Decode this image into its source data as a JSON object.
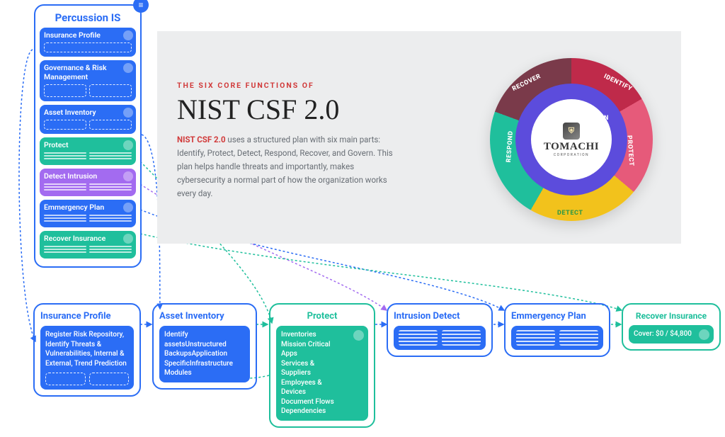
{
  "sidebar": {
    "title": "Percussion IS",
    "items": [
      {
        "label": "Insurance Profile",
        "color": "blue",
        "variant": "bar"
      },
      {
        "label": "Governance & Risk Management",
        "color": "blue",
        "variant": "row"
      },
      {
        "label": "Asset Inventory",
        "color": "blue",
        "variant": "row"
      },
      {
        "label": "Protect",
        "color": "teal",
        "variant": "lines"
      },
      {
        "label": "Detect Intrusion",
        "color": "purple",
        "variant": "lines"
      },
      {
        "label": "Emmergency Plan",
        "color": "blue",
        "variant": "lines"
      },
      {
        "label": "Recover Insurance",
        "color": "teal",
        "variant": "lines"
      }
    ]
  },
  "info": {
    "eyebrow": "THE SIX CORE FUNCTIONS OF",
    "heading": "NIST CSF 2.0",
    "lead": "NIST CSF 2.0",
    "body": " uses a structured plan with six main parts: Identify, Protect, Detect, Respond, Recover, and Govern. This plan helps handle threats and importantly, makes cybersecurity a normal part of how the organization works every day."
  },
  "donut": {
    "center_brand": "TOMACHI",
    "center_sub": "CORPORATION",
    "segments": {
      "govern": "GOVERN",
      "identify": "IDENTIFY",
      "protect": "PROTECT",
      "detect": "DETECT",
      "respond": "RESPOND",
      "recover": "RECOVER"
    }
  },
  "bottom": [
    {
      "title": "Insurance Profile",
      "style": "blue",
      "body": "Register Risk Repository, Identify Threats & Vulnerabilities, Internal & External, Trend Prediction"
    },
    {
      "title": "Asset Inventory",
      "style": "blue",
      "body": "Identify assetsUnstructured BackupsApplication SpecificInfrastructure Modules"
    },
    {
      "title": "Protect",
      "style": "teal",
      "body": "Inventories Mission Critical Apps Services & Suppliers Employees & Devices Document Flows Dependencies"
    },
    {
      "title": "Intrusion Detect",
      "style": "blue",
      "body": ""
    },
    {
      "title": "Emmergency Plan",
      "style": "blue",
      "body": ""
    },
    {
      "title": "Recover Insurance",
      "style": "teal",
      "body": "Cover: $0 / $4,800"
    }
  ],
  "chart_data": {
    "type": "pie",
    "title": "The Six Core Functions of NIST CSF 2.0",
    "series": [
      {
        "name": "GOVERN",
        "color": "#5c4cdc",
        "note": "inner ring"
      },
      {
        "name": "IDENTIFY",
        "color": "#bf2a4a"
      },
      {
        "name": "PROTECT",
        "color": "#e65a7a"
      },
      {
        "name": "DETECT",
        "color": "#f2c21c"
      },
      {
        "name": "RESPOND",
        "color": "#1fbf9c"
      },
      {
        "name": "RECOVER",
        "color": "#7a3a4a"
      }
    ],
    "note": "Donut shows six equal NIST CSF 2.0 functions; outer ring five segments, Govern as inner ring."
  }
}
